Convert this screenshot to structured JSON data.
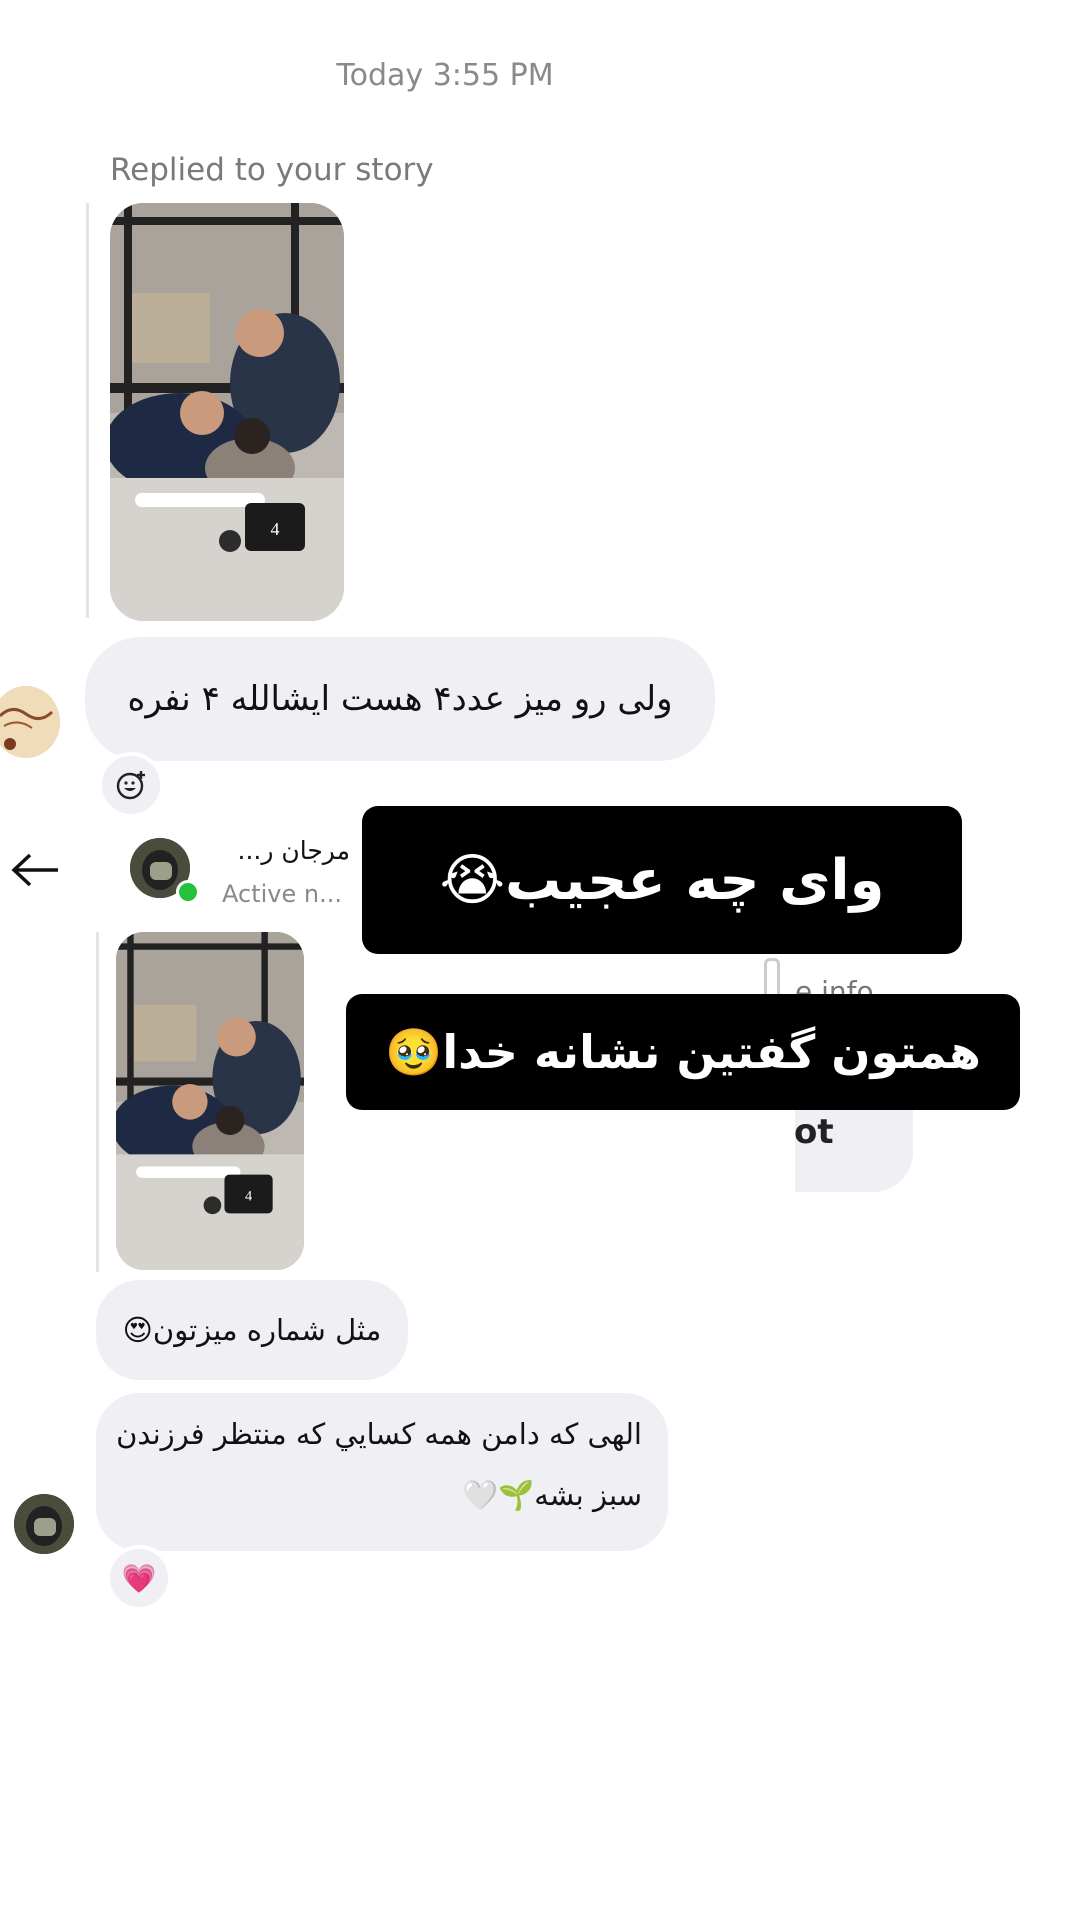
{
  "chat": {
    "timestamp": "Today 3:55 PM",
    "replied_label": "Replied to your story",
    "message_1": "ولی رو میز عدد۴ هست ایشالله ۴ نفره",
    "story_table_number": "4"
  },
  "embedded_header": {
    "name": "مرجان ر...",
    "status": "Active n...",
    "partial_info": "e info",
    "partial_text": "ot"
  },
  "embedded_chat": {
    "message_2": "مثل شماره میزتون😍",
    "message_3_line1": "الهی که دامن همه کسايي که منتظر فرزندن",
    "message_3_line2": "سبز بشه🌱🤍"
  },
  "overlays": {
    "caption_1": "وای چه عجیب😭",
    "caption_2": "همتون گفتین نشانه خدا🥹"
  },
  "reactions": {
    "heart": "💗"
  },
  "colors": {
    "bubble_bg": "#efeff4",
    "active_dot": "#22c33a",
    "overlay_bg": "#000000"
  }
}
